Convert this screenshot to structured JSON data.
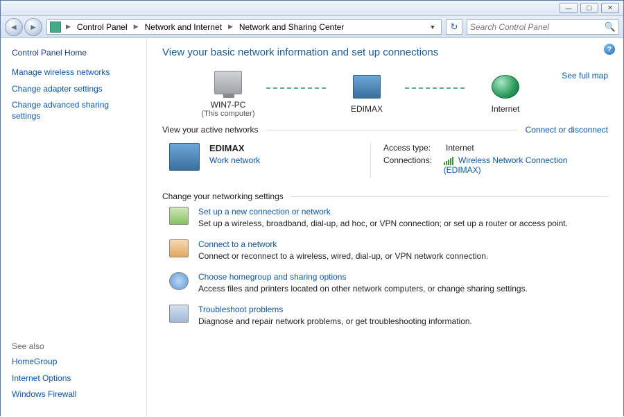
{
  "titlebar": {
    "min": "—",
    "max": "▢",
    "close": "✕"
  },
  "breadcrumb": [
    "Control Panel",
    "Network and Internet",
    "Network and Sharing Center"
  ],
  "search": {
    "placeholder": "Search Control Panel"
  },
  "sidebar": {
    "home": "Control Panel Home",
    "links": [
      "Manage wireless networks",
      "Change adapter settings",
      "Change advanced sharing settings"
    ],
    "seealso_head": "See also",
    "seealso": [
      "HomeGroup",
      "Internet Options",
      "Windows Firewall"
    ]
  },
  "page": {
    "title": "View your basic network information and set up connections",
    "fullmap": "See full map",
    "map": {
      "node1_label": "WIN7-PC",
      "node1_sub": "(This computer)",
      "node2_label": "EDIMAX",
      "node3_label": "Internet"
    },
    "active": {
      "heading": "View your active networks",
      "action": "Connect or disconnect",
      "name": "EDIMAX",
      "type": "Work network",
      "access_key": "Access type:",
      "access_val": "Internet",
      "conn_key": "Connections:",
      "conn_val": "Wireless Network Connection (EDIMAX)"
    },
    "settings": {
      "heading": "Change your networking settings",
      "tasks": [
        {
          "title": "Set up a new connection or network",
          "desc": "Set up a wireless, broadband, dial-up, ad hoc, or VPN connection; or set up a router or access point."
        },
        {
          "title": "Connect to a network",
          "desc": "Connect or reconnect to a wireless, wired, dial-up, or VPN network connection."
        },
        {
          "title": "Choose homegroup and sharing options",
          "desc": "Access files and printers located on other network computers, or change sharing settings."
        },
        {
          "title": "Troubleshoot problems",
          "desc": "Diagnose and repair network problems, or get troubleshooting information."
        }
      ]
    }
  }
}
